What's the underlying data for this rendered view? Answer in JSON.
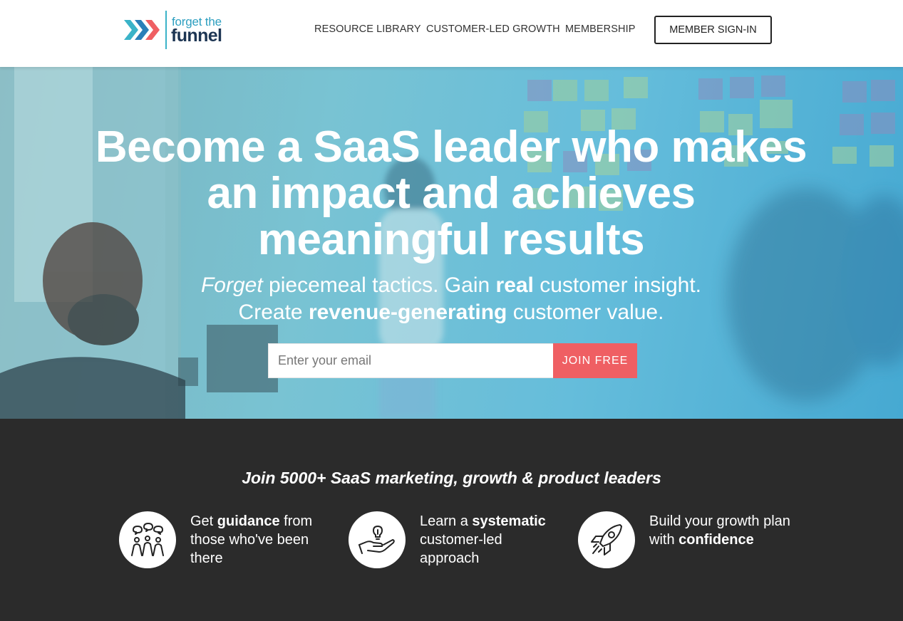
{
  "header": {
    "logo": {
      "line1": "forget the",
      "line2": "funnel"
    },
    "nav": [
      "RESOURCE LIBRARY",
      "CUSTOMER-LED GROWTH",
      "MEMBERSHIP"
    ],
    "signin_label": "MEMBER SIGN-IN"
  },
  "hero": {
    "title": "Become a SaaS leader who makes an impact and achieves meaningful results",
    "subtitle": {
      "line1": {
        "a": "Forget",
        "b": " piecemeal tactics. Gain ",
        "c": "real",
        "d": " customer insight."
      },
      "line2": {
        "a": "Create ",
        "b": "revenue-generating",
        "c": " customer value."
      }
    },
    "email_placeholder": "Enter your email",
    "join_label": "JOIN FREE"
  },
  "social": {
    "heading": "Join 5000+ SaaS marketing, growth & product leaders",
    "features": [
      {
        "icon": "people-discussion-icon",
        "pre": "Get ",
        "bold": "guidance",
        "post": " from those who've been there"
      },
      {
        "icon": "hand-lightbulb-icon",
        "pre": "Learn a ",
        "bold": "systematic",
        "post": " customer-led approach"
      },
      {
        "icon": "rocket-icon",
        "pre": "Build your growth plan with ",
        "bold": "confidence",
        "post": ""
      }
    ]
  },
  "colors": {
    "brand_navy": "#1d3553",
    "brand_teal": "#2d9fc0",
    "cta_coral": "#ef5f63",
    "dark_bg": "#2b2b2b"
  }
}
